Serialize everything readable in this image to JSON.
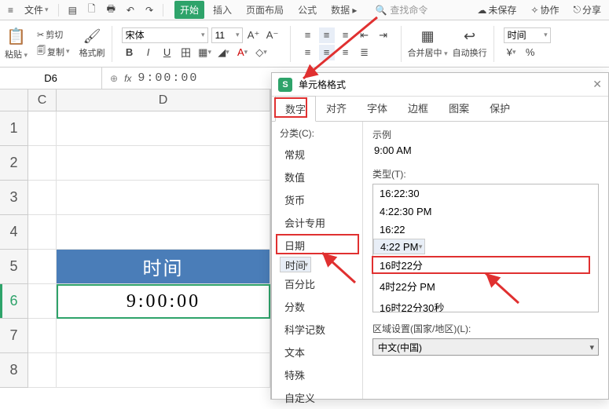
{
  "menubar": {
    "file": "文件",
    "tabs": [
      "开始",
      "插入",
      "页面布局",
      "公式",
      "数据"
    ],
    "active_tab_index": 0,
    "search_placeholder": "查找命令",
    "right": {
      "unsaved": "未保存",
      "collab": "协作",
      "share": "分享"
    }
  },
  "ribbon": {
    "paste": "粘贴",
    "cut": "剪切",
    "copy": "复制",
    "formatpainter": "格式刷",
    "font_family": "宋体",
    "font_size": "11",
    "merge": "合并居中",
    "wrap": "自动换行",
    "numfmt": "时间",
    "currency": "¥",
    "percent": "%"
  },
  "formula_bar": {
    "cell_ref": "D6",
    "fx_label": "fx",
    "value": "9:00:00"
  },
  "sheet": {
    "col_labels": [
      "C",
      "D"
    ],
    "row_labels": [
      "1",
      "2",
      "3",
      "4",
      "5",
      "6",
      "7",
      "8"
    ],
    "d5_value": "时间",
    "d6_value": "9:00:00"
  },
  "dialog": {
    "title": "单元格格式",
    "tabs": [
      "数字",
      "对齐",
      "字体",
      "边框",
      "图案",
      "保护"
    ],
    "active_tab_index": 0,
    "category_label": "分类(C):",
    "categories": [
      "常规",
      "数值",
      "货币",
      "会计专用",
      "日期",
      "时间",
      "百分比",
      "分数",
      "科学记数",
      "文本",
      "特殊",
      "自定义"
    ],
    "selected_category_index": 5,
    "sample_label": "示例",
    "sample_value": "9:00 AM",
    "type_label": "类型(T):",
    "type_options": [
      "16:22:30",
      "4:22:30 PM",
      "16:22",
      "4:22 PM",
      "16时22分",
      "4时22分 PM",
      "16时22分30秒"
    ],
    "selected_type_index": 3,
    "locale_label": "区域设置(国家/地区)(L):",
    "locale_value": "中文(中国)"
  }
}
